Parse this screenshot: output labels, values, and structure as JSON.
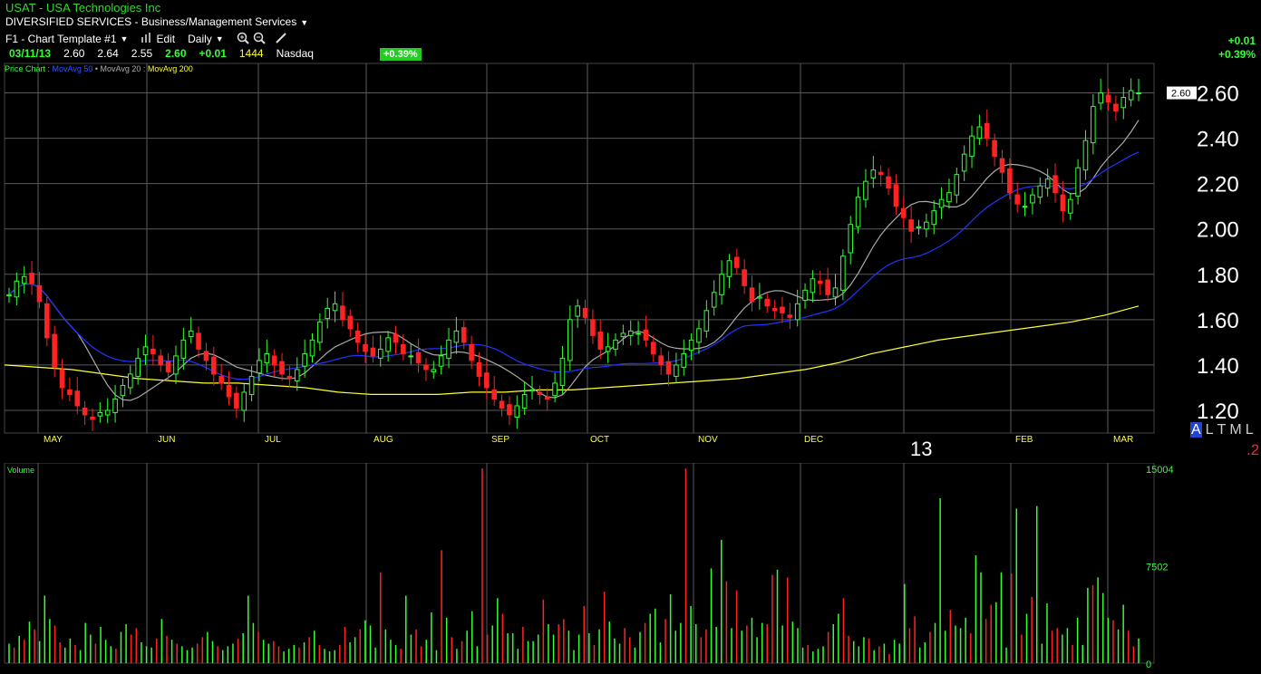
{
  "header": {
    "title": "USAT - USA Technologies Inc",
    "sector": "DIVERSIFIED SERVICES - Business/Management Services",
    "template": "F1 - Chart Template #1",
    "edit_label": "Edit",
    "period": "Daily",
    "quote": {
      "date": "03/11/13",
      "open": "2.60",
      "high": "2.64",
      "low": "2.55",
      "close": "2.60",
      "change": "+0.01",
      "time": "1444",
      "exchange": "Nasdaq",
      "change_pct": "+0.39%"
    },
    "right_change": "+0.01",
    "right_change_pct": "+0.39%"
  },
  "legend": {
    "price_chart": "Price Chart",
    "ma50": "MovAvg 50",
    "ma20": "MovAvg 20",
    "ma200": "MovAvg 200"
  },
  "icons": {
    "dropdown": "chevron-down-icon",
    "edit": "bar-chart-icon",
    "zoom_in": "zoom-in-icon",
    "zoom_out": "zoom-out-icon",
    "draw": "pencil-icon"
  },
  "colors": {
    "background": "#000000",
    "up": "#33ff33",
    "down": "#ff2222",
    "grid": "#5a5a5a",
    "ma50": "#2233ff",
    "ma20": "#aaaaaa",
    "ma200": "#ffff33",
    "months": "#ffff33"
  },
  "last_price_tag": "2.60",
  "year_label": "13",
  "timeframes": {
    "options": [
      "A",
      "L",
      "T",
      "M",
      "L"
    ],
    "selected": "A"
  },
  "page_indicator": ".2",
  "chart_data": [
    {
      "type": "candlestick",
      "title": "USAT - USA Technologies Inc",
      "x_labels": [
        "MAY",
        "JUN",
        "JUL",
        "AUG",
        "SEP",
        "OCT",
        "NOV",
        "DEC",
        "FEB",
        "MAR"
      ],
      "y_ticks": [
        "1.20",
        "1.40",
        "1.60",
        "1.80",
        "2.00",
        "2.20",
        "2.40",
        "2.60"
      ],
      "ylim": [
        1.1,
        2.73
      ],
      "grid": true,
      "last_close": 2.6,
      "closes": [
        1.71,
        1.77,
        1.79,
        1.76,
        1.68,
        1.52,
        1.39,
        1.3,
        1.27,
        1.22,
        1.18,
        1.16,
        1.19,
        1.2,
        1.25,
        1.31,
        1.36,
        1.43,
        1.48,
        1.45,
        1.4,
        1.37,
        1.44,
        1.51,
        1.55,
        1.47,
        1.42,
        1.36,
        1.32,
        1.26,
        1.21,
        1.28,
        1.35,
        1.42,
        1.45,
        1.4,
        1.36,
        1.34,
        1.38,
        1.45,
        1.51,
        1.59,
        1.65,
        1.67,
        1.6,
        1.56,
        1.5,
        1.46,
        1.44,
        1.47,
        1.52,
        1.5,
        1.45,
        1.44,
        1.41,
        1.38,
        1.38,
        1.44,
        1.51,
        1.55,
        1.5,
        1.42,
        1.35,
        1.3,
        1.25,
        1.21,
        1.18,
        1.22,
        1.27,
        1.29,
        1.27,
        1.25,
        1.32,
        1.43,
        1.6,
        1.66,
        1.61,
        1.53,
        1.47,
        1.48,
        1.51,
        1.54,
        1.55,
        1.54,
        1.51,
        1.45,
        1.4,
        1.36,
        1.4,
        1.45,
        1.51,
        1.56,
        1.64,
        1.72,
        1.8,
        1.86,
        1.83,
        1.75,
        1.68,
        1.7,
        1.66,
        1.64,
        1.63,
        1.61,
        1.67,
        1.73,
        1.78,
        1.76,
        1.71,
        1.74,
        1.88,
        2.02,
        2.14,
        2.21,
        2.26,
        2.24,
        2.18,
        2.1,
        2.05,
        1.99,
        2.01,
        2.03,
        2.08,
        2.13,
        2.16,
        2.24,
        2.33,
        2.41,
        2.45,
        2.4,
        2.32,
        2.25,
        2.16,
        2.11,
        2.1,
        2.15,
        2.19,
        2.22,
        2.16,
        2.08,
        2.13,
        2.27,
        2.39,
        2.54,
        2.6,
        2.56,
        2.52,
        2.58,
        2.61,
        2.6
      ],
      "series": [
        {
          "name": "MovAvg 50",
          "color": "#2233ff"
        },
        {
          "name": "MovAvg 20",
          "color": "#aaaaaa"
        },
        {
          "name": "MovAvg 200",
          "color": "#ffff33",
          "values": [
            1.4,
            1.39,
            1.38,
            1.36,
            1.34,
            1.33,
            1.32,
            1.32,
            1.31,
            1.3,
            1.28,
            1.27,
            1.27,
            1.27,
            1.28,
            1.28,
            1.29,
            1.29,
            1.3,
            1.31,
            1.32,
            1.33,
            1.34,
            1.36,
            1.38,
            1.41,
            1.45,
            1.48,
            1.51,
            1.53,
            1.55,
            1.57,
            1.59,
            1.62,
            1.66
          ]
        }
      ]
    },
    {
      "type": "bar",
      "title": "Volume",
      "y_ticks": [
        "15004",
        "7502",
        "0"
      ],
      "ylim": [
        0,
        15004
      ],
      "values": [
        1500,
        1200,
        2100,
        1800,
        3200,
        2600,
        1700,
        5200,
        3400,
        2900,
        1600,
        1200,
        1900,
        1400,
        1000,
        3100,
        2200,
        1500,
        2800,
        1800,
        1300,
        1100,
        2400,
        3000,
        2200,
        2700,
        1600,
        1300,
        1200,
        1900,
        3400,
        2100,
        1800,
        1500,
        1300,
        1000,
        1200,
        1500,
        2000,
        2400,
        1700,
        1300,
        1000,
        1300,
        1500,
        1900,
        2300,
        5200,
        3100,
        2400,
        1800,
        1500,
        1700,
        1300,
        900,
        1100,
        1400,
        1200,
        1600,
        2000,
        2500,
        1400,
        1100,
        900,
        1000,
        1400,
        2800,
        1600,
        2000,
        2600,
        3300,
        2900,
        1200,
        7000,
        2600,
        1800,
        1400,
        1100,
        5200,
        2200,
        2600,
        1300,
        1800,
        3900,
        1000,
        8700,
        3500,
        2000,
        1100,
        1700,
        2500,
        4000,
        1300,
        15004,
        2200,
        2900,
        5000,
        3800,
        2300,
        2300,
        1100,
        2800,
        1700,
        1700,
        2200,
        4900,
        3000,
        2200,
        3000,
        3400,
        2500,
        1000,
        2200,
        4400,
        2300,
        1400,
        2600,
        5500,
        3200,
        1900,
        1500,
        2700,
        2000,
        1200,
        2400,
        3100,
        3800,
        4200,
        1600,
        3400,
        5300,
        2500,
        3100,
        15004,
        4400,
        3000,
        2000,
        2600,
        7300,
        2800,
        9500,
        6300,
        2700,
        5600,
        2500,
        2900,
        3500,
        2000,
        3100,
        3000,
        6800,
        7200,
        2900,
        6600,
        3200,
        2700,
        1200,
        1400,
        900,
        1100,
        1300,
        2400,
        3000,
        3800,
        5000,
        2100,
        1700,
        1300,
        2000,
        1900,
        1000,
        1300,
        1500,
        700,
        1800,
        1500,
        6100,
        2700,
        3600,
        1200,
        1600,
        2400,
        3100,
        12700,
        2500,
        4100,
        2900,
        2700,
        3500,
        2300,
        8300,
        7000,
        3400,
        4500,
        4700,
        7000,
        1200,
        6900,
        11900,
        2200,
        3800,
        5100,
        12100,
        1500,
        4600,
        2500,
        2700,
        2200,
        2700,
        1400,
        3500,
        1400,
        5800,
        6000,
        6600,
        5400,
        3500,
        3300,
        2600,
        4500,
        2500,
        1300,
        1900
      ]
    }
  ]
}
